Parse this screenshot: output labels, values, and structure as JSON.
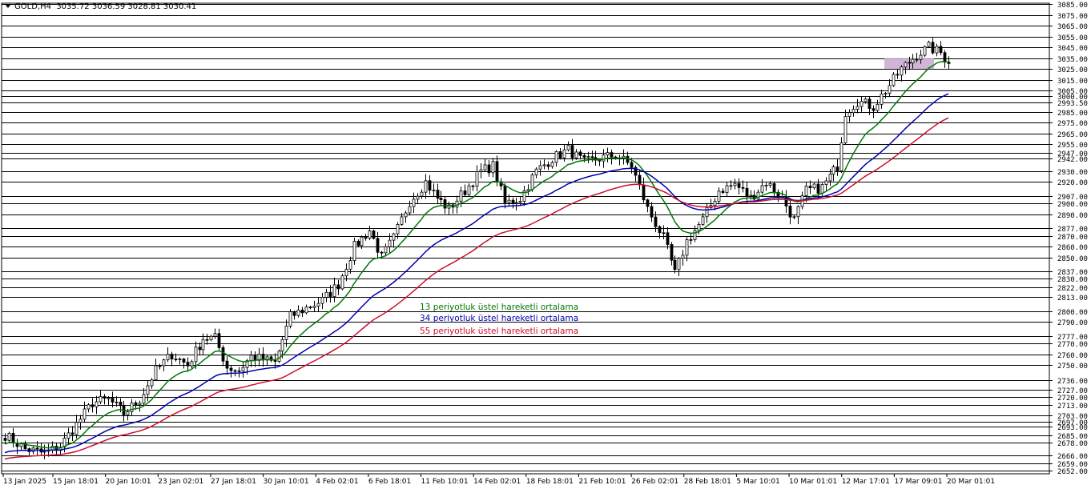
{
  "header": {
    "symbol": "GOLD,H4",
    "ohlc": "3035.72 3036.59 3028.81 3030.41"
  },
  "chart_data": {
    "type": "candlestick",
    "title": "",
    "xlabel": "",
    "ylabel": "",
    "ylim": [
      2649,
      3086
    ],
    "grid": false,
    "y_ticks": [
      "3085.00",
      "3075.00",
      "3065.00",
      "3055.00",
      "3045.00",
      "3035.00",
      "3025.00",
      "3015.00",
      "3005.00",
      "3000.00",
      "2993.50",
      "2985.00",
      "2975.00",
      "2965.00",
      "2955.00",
      "2947.00",
      "2942.00",
      "2930.00",
      "2920.00",
      "2907.00",
      "2900.00",
      "2890.00",
      "2877.00",
      "2870.00",
      "2860.00",
      "2850.00",
      "2837.00",
      "2830.00",
      "2822.00",
      "2813.00",
      "2800.00",
      "2790.00",
      "2777.00",
      "2770.00",
      "2760.00",
      "2750.00",
      "2736.00",
      "2727.00",
      "2720.00",
      "2713.00",
      "2703.00",
      "2697.00",
      "2693.00",
      "2685.00",
      "2678.00",
      "2666.00",
      "2659.00",
      "2652.00"
    ],
    "x_ticks": [
      "13 Jan 2025",
      "15 Jan 18:01",
      "20 Jan 10:01",
      "23 Jan 02:01",
      "27 Jan 18:01",
      "30 Jan 10:01",
      "4 Feb 02:01",
      "6 Feb 18:01",
      "11 Feb 10:01",
      "14 Feb 02:01",
      "18 Feb 18:01",
      "21 Feb 10:01",
      "26 Feb 02:01",
      "28 Feb 18:01",
      "5 Mar 10:01",
      "10 Mar 01:01",
      "12 Mar 17:01",
      "17 Mar 09:01",
      "20 Mar 01:01"
    ],
    "price_path": [
      [
        0,
        2685
      ],
      [
        5,
        2672
      ],
      [
        10,
        2668
      ],
      [
        14,
        2675
      ],
      [
        18,
        2695
      ],
      [
        22,
        2715
      ],
      [
        26,
        2718
      ],
      [
        30,
        2705
      ],
      [
        34,
        2718
      ],
      [
        38,
        2745
      ],
      [
        42,
        2760
      ],
      [
        46,
        2750
      ],
      [
        50,
        2775
      ],
      [
        53,
        2775
      ],
      [
        56,
        2748
      ],
      [
        59,
        2745
      ],
      [
        62,
        2758
      ],
      [
        65,
        2755
      ],
      [
        68,
        2752
      ],
      [
        72,
        2795
      ],
      [
        76,
        2803
      ],
      [
        80,
        2810
      ],
      [
        84,
        2825
      ],
      [
        88,
        2860
      ],
      [
        92,
        2875
      ],
      [
        95,
        2850
      ],
      [
        98,
        2868
      ],
      [
        102,
        2902
      ],
      [
        106,
        2920
      ],
      [
        109,
        2905
      ],
      [
        112,
        2895
      ],
      [
        116,
        2912
      ],
      [
        120,
        2930
      ],
      [
        123,
        2935
      ],
      [
        126,
        2900
      ],
      [
        130,
        2905
      ],
      [
        134,
        2930
      ],
      [
        138,
        2942
      ],
      [
        142,
        2950
      ],
      [
        146,
        2938
      ],
      [
        150,
        2942
      ],
      [
        154,
        2945
      ],
      [
        158,
        2935
      ],
      [
        162,
        2895
      ],
      [
        166,
        2868
      ],
      [
        169,
        2835
      ],
      [
        172,
        2865
      ],
      [
        176,
        2885
      ],
      [
        180,
        2912
      ],
      [
        184,
        2918
      ],
      [
        188,
        2905
      ],
      [
        192,
        2920
      ],
      [
        196,
        2905
      ],
      [
        199,
        2885
      ],
      [
        202,
        2912
      ],
      [
        206,
        2915
      ],
      [
        210,
        2935
      ],
      [
        212,
        2985
      ],
      [
        215,
        2995
      ],
      [
        219,
        2990
      ],
      [
        222,
        3005
      ],
      [
        226,
        3025
      ],
      [
        230,
        3038
      ],
      [
        233,
        3045
      ],
      [
        236,
        3040
      ],
      [
        238,
        3030
      ]
    ],
    "series": [
      {
        "name": "13 periyotluk üstel hareketli ortalama",
        "color": "#007a00"
      },
      {
        "name": "34 periyotluk üstel hareketli ortalama",
        "color": "#0000b4"
      },
      {
        "name": "55 periyotluk üstel hareketli ortalama",
        "color": "#cc1030"
      }
    ],
    "highlight_zone": {
      "y_range": [
        3025,
        3035
      ],
      "color": "#c8a8d0"
    },
    "colors": {
      "up": "#000000",
      "down": "#000000",
      "background": "#ffffff",
      "hline": "#000000"
    }
  }
}
